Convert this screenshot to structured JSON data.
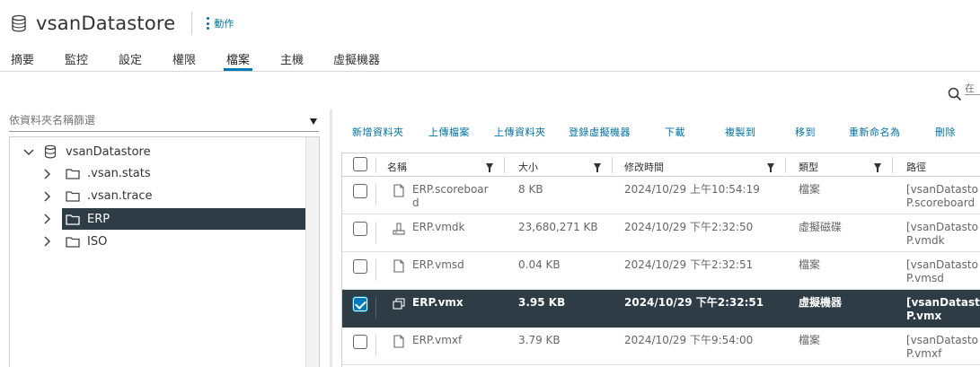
{
  "header": {
    "title": "vsanDatastore",
    "actions_label": "動作",
    "title_icon": "database-icon",
    "actions_icon": "kebab-icon"
  },
  "tabs": [
    {
      "label": "摘要",
      "active": false
    },
    {
      "label": "監控",
      "active": false
    },
    {
      "label": "設定",
      "active": false
    },
    {
      "label": "權限",
      "active": false
    },
    {
      "label": "檔案",
      "active": true
    },
    {
      "label": "主機",
      "active": false
    },
    {
      "label": "虛擬機器",
      "active": false
    }
  ],
  "search": {
    "placeholder": "在",
    "icon": "search-icon"
  },
  "folder_filter": {
    "placeholder": "依資料夾名稱篩選"
  },
  "tree": {
    "root": {
      "label": "vsanDatastore",
      "expanded": true,
      "icon": "database-icon"
    },
    "children": [
      {
        "label": ".vsan.stats",
        "selected": false,
        "icon": "folder-icon"
      },
      {
        "label": ".vsan.trace",
        "selected": false,
        "icon": "folder-icon"
      },
      {
        "label": "ERP",
        "selected": true,
        "icon": "folder-icon"
      },
      {
        "label": "ISO",
        "selected": false,
        "icon": "folder-icon"
      }
    ]
  },
  "toolbar": {
    "new_folder": "新增資料夾",
    "upload_file": "上傳檔案",
    "upload_folder": "上傳資料夾",
    "register_vm": "登錄虛擬機器",
    "download": "下載",
    "copy_to": "複製到",
    "move_to": "移到",
    "rename_to": "重新命名為",
    "delete": "刪除"
  },
  "table": {
    "columns": {
      "name": "名稱",
      "size": "大小",
      "modified": "修改時間",
      "type": "類型",
      "path": "路徑"
    },
    "rows": [
      {
        "icon": "file-icon",
        "name_line1": "ERP.scoreboar",
        "name_line2": "d",
        "size": "8 KB",
        "modified": "2024/10/29 上午10:54:19",
        "type": "檔案",
        "path_line1": "[vsanDatasto",
        "path_line2": "P.scoreboard",
        "checked": false
      },
      {
        "icon": "virtual-disk-icon",
        "name_line1": "ERP.vmdk",
        "name_line2": "",
        "size": "23,680,271 KB",
        "modified": "2024/10/29 下午2:32:50",
        "type": "虛擬磁碟",
        "path_line1": "[vsanDatasto",
        "path_line2": "P.vmdk",
        "checked": false
      },
      {
        "icon": "file-icon",
        "name_line1": "ERP.vmsd",
        "name_line2": "",
        "size": "0.04 KB",
        "modified": "2024/10/29 下午2:32:51",
        "type": "檔案",
        "path_line1": "[vsanDatasto",
        "path_line2": "P.vmsd",
        "checked": false
      },
      {
        "icon": "vm-icon",
        "name_line1": "ERP.vmx",
        "name_line2": "",
        "size": "3.95 KB",
        "modified": "2024/10/29 下午2:32:51",
        "type": "虛擬機器",
        "path_line1": "[vsanDatasto",
        "path_line2": "P.vmx",
        "checked": true
      },
      {
        "icon": "file-icon",
        "name_line1": "ERP.vmxf",
        "name_line2": "",
        "size": "3.79 KB",
        "modified": "2024/10/29 下午9:54:00",
        "type": "檔案",
        "path_line1": "[vsanDatasto",
        "path_line2": "P.vmxf",
        "checked": false
      }
    ]
  },
  "colors": {
    "accent": "#0072a3",
    "selected_row": "#2d3c45",
    "tab_underline": "#0079b8"
  }
}
